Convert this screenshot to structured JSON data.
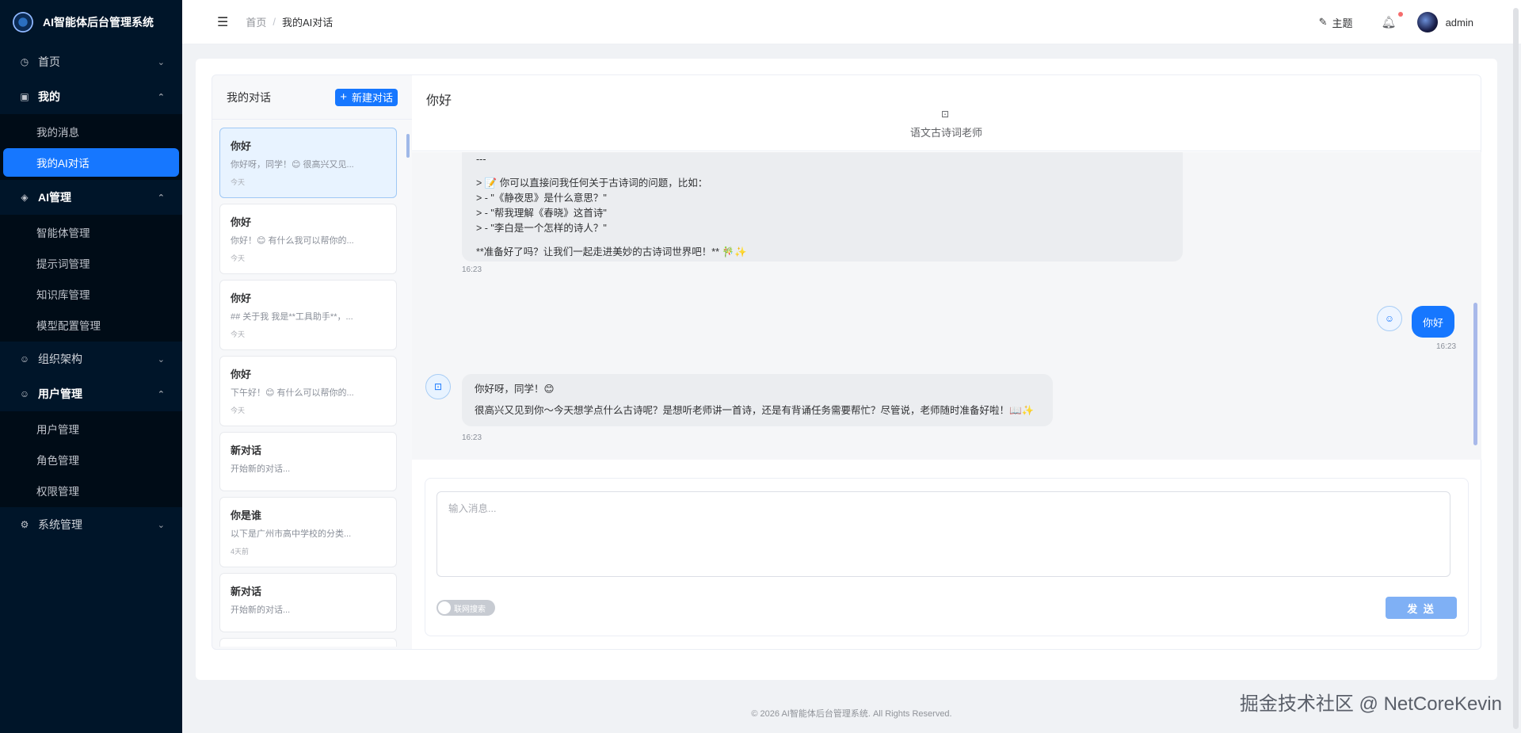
{
  "app": {
    "title": "AI智能体后台管理系统"
  },
  "sidebar": {
    "items": [
      {
        "label": "首页",
        "icon": "dashboard-icon",
        "open": false
      },
      {
        "label": "我的",
        "icon": "profile-icon",
        "open": true,
        "children": [
          "我的消息",
          "我的AI对话"
        ]
      },
      {
        "label": "AI管理",
        "icon": "ai-icon",
        "open": true,
        "children": [
          "智能体管理",
          "提示词管理",
          "知识库管理",
          "模型配置管理"
        ]
      },
      {
        "label": "组织架构",
        "icon": "org-icon",
        "open": false
      },
      {
        "label": "用户管理",
        "icon": "user-icon",
        "open": true,
        "children": [
          "用户管理",
          "角色管理",
          "权限管理"
        ]
      },
      {
        "label": "系统管理",
        "icon": "gear-icon",
        "open": false
      }
    ],
    "active": "我的AI对话"
  },
  "header": {
    "breadcrumb": [
      "首页",
      "我的AI对话"
    ],
    "theme_label": "主题",
    "username": "admin"
  },
  "conversations": {
    "title": "我的对话",
    "new_button": "新建对话",
    "items": [
      {
        "title": "你好",
        "preview": "你好呀，同学！😊 很高兴又见...",
        "time": "今天",
        "active": true
      },
      {
        "title": "你好",
        "preview": "你好！😊 有什么我可以帮你的...",
        "time": "今天"
      },
      {
        "title": "你好",
        "preview": "## 关于我 我是**工具助手**，...",
        "time": "今天"
      },
      {
        "title": "你好",
        "preview": "下午好！😊 有什么可以帮你的...",
        "time": "今天"
      },
      {
        "title": "新对话",
        "preview": "开始新的对话...",
        "time": ""
      },
      {
        "title": "你是谁",
        "preview": "以下是广州市高中学校的分类...",
        "time": "4天前"
      },
      {
        "title": "新对话",
        "preview": "开始新的对话...",
        "time": ""
      }
    ]
  },
  "chat": {
    "title": "你好",
    "agent_name": "语文古诗词老师",
    "messages": [
      {
        "role": "assistant",
        "lines": [
          "---",
          "",
          "> 📝 你可以直接问我任何关于古诗词的问题，比如：",
          "> - \"《静夜思》是什么意思？\"",
          "> - \"帮我理解《春晓》这首诗\"",
          "> - \"李白是一个怎样的诗人？\"",
          "",
          "**准备好了吗？让我们一起走进美妙的古诗词世界吧！** 🎋✨"
        ],
        "time": "16:23"
      },
      {
        "role": "user",
        "text": "你好",
        "time": "16:23"
      },
      {
        "role": "assistant",
        "lines": [
          "你好呀，同学！😊",
          "",
          "很高兴又见到你～今天想学点什么古诗呢？是想听老师讲一首诗，还是有背诵任务需要帮忙？尽管说，老师随时准备好啦！📖✨"
        ],
        "time": "16:23"
      }
    ],
    "input_placeholder": "输入消息...",
    "web_search_label": "联网搜索",
    "send_label": "发 送"
  },
  "footer": {
    "copyright": "© 2026 AI智能体后台管理系统. All Rights Reserved."
  },
  "watermark": "掘金技术社区 @ NetCoreKevin",
  "colors": {
    "sidebar_bg": "#001529",
    "accent": "#1677ff"
  }
}
